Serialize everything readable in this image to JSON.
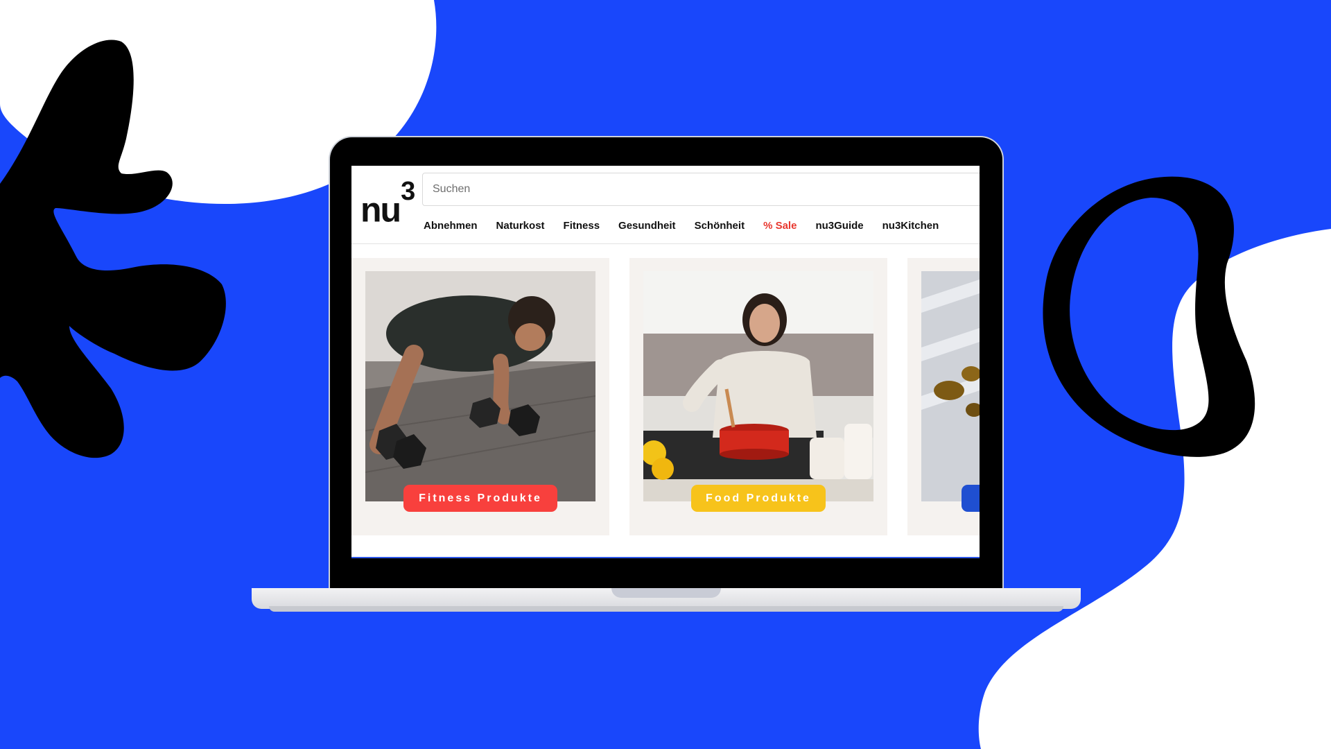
{
  "colors": {
    "background": "#1947fb",
    "blob_white": "#ffffff",
    "blob_black": "#000000",
    "sale_red": "#e8372e",
    "fitness_badge": "#f8403d",
    "food_badge": "#f7c31b",
    "third_badge": "#1f4fd1"
  },
  "site": {
    "logo_text": "nu",
    "logo_sup": "3",
    "search_placeholder": "Suchen"
  },
  "nav": [
    {
      "label": "Abnehmen"
    },
    {
      "label": "Naturkost"
    },
    {
      "label": "Fitness"
    },
    {
      "label": "Gesundheit"
    },
    {
      "label": "Schönheit"
    },
    {
      "label": "% Sale"
    },
    {
      "label": "nu3Guide"
    },
    {
      "label": "nu3Kitchen"
    }
  ],
  "cards": [
    {
      "badge": "Fitness Produkte",
      "image": "man doing push-ups on dumbbells",
      "icon": "fitness-photo"
    },
    {
      "badge": "Food Produkte",
      "image": "woman cooking at stove",
      "icon": "food-photo"
    },
    {
      "badge": "",
      "image": "supplement capsules in sunlight",
      "icon": "supplements-photo"
    }
  ]
}
